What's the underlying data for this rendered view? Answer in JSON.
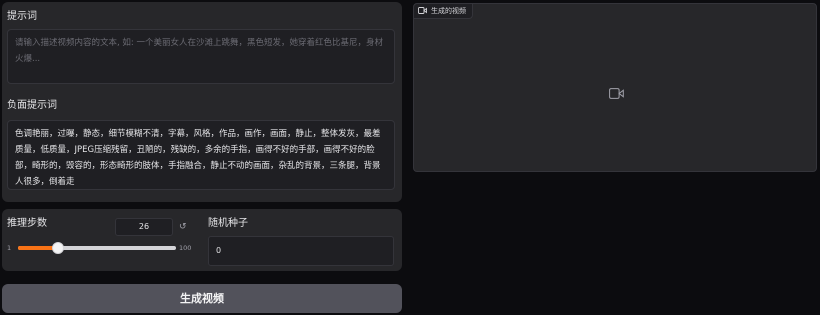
{
  "prompt": {
    "label": "提示词",
    "placeholder": "请输入描述视频内容的文本, 如: 一个美丽女人在沙滩上跳舞，黑色短发，她穿着红色比基尼，身材火爆..."
  },
  "negative_prompt": {
    "label": "负面提示词",
    "value": "色调艳丽，过曝，静态，细节模糊不清，字幕，风格，作品，画作，画面，静止，整体发灰，最差质量，低质量，JPEG压缩残留，丑陋的，残缺的，多余的手指，画得不好的手部，画得不好的脸部，畸形的，毁容的，形态畸形的肢体，手指融合，静止不动的画面，杂乱的背景，三条腿，背景人很多，倒着走"
  },
  "steps": {
    "label": "推理步数",
    "value": "26",
    "min": "1",
    "max": "100",
    "fraction": 0.2525,
    "reset_icon": "reset-icon"
  },
  "seed": {
    "label": "随机种子",
    "value": "0"
  },
  "generate_button": {
    "label": "生成视频"
  },
  "output_video": {
    "label": "生成的视频",
    "icon": "video-camera-icon"
  },
  "colors": {
    "accent": "#f97316",
    "panel": "#27272a",
    "background": "#0c0c0f"
  }
}
